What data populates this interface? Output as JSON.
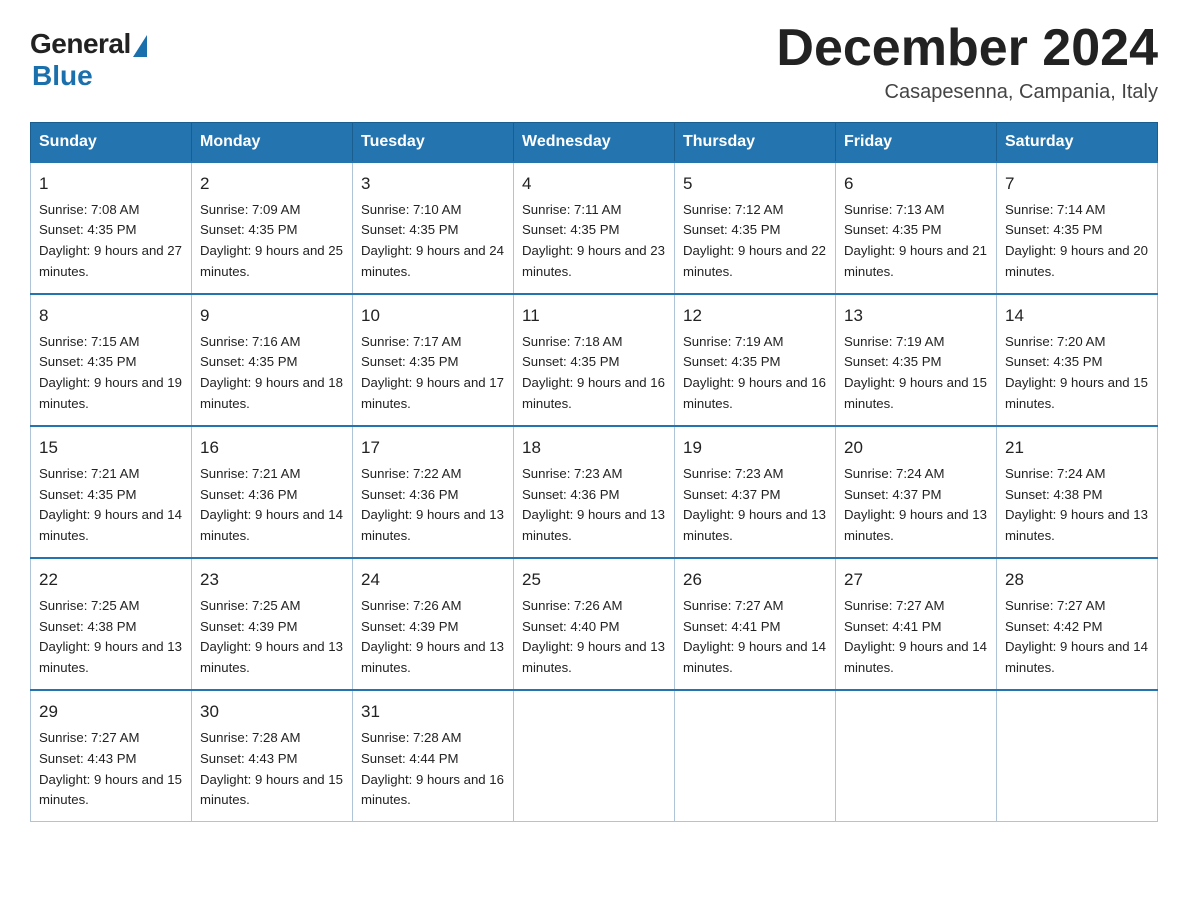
{
  "logo": {
    "general": "General",
    "blue": "Blue"
  },
  "title": {
    "month_year": "December 2024",
    "location": "Casapesenna, Campania, Italy"
  },
  "header_days": [
    "Sunday",
    "Monday",
    "Tuesday",
    "Wednesday",
    "Thursday",
    "Friday",
    "Saturday"
  ],
  "weeks": [
    [
      {
        "day": "1",
        "sunrise": "7:08 AM",
        "sunset": "4:35 PM",
        "daylight": "9 hours and 27 minutes."
      },
      {
        "day": "2",
        "sunrise": "7:09 AM",
        "sunset": "4:35 PM",
        "daylight": "9 hours and 25 minutes."
      },
      {
        "day": "3",
        "sunrise": "7:10 AM",
        "sunset": "4:35 PM",
        "daylight": "9 hours and 24 minutes."
      },
      {
        "day": "4",
        "sunrise": "7:11 AM",
        "sunset": "4:35 PM",
        "daylight": "9 hours and 23 minutes."
      },
      {
        "day": "5",
        "sunrise": "7:12 AM",
        "sunset": "4:35 PM",
        "daylight": "9 hours and 22 minutes."
      },
      {
        "day": "6",
        "sunrise": "7:13 AM",
        "sunset": "4:35 PM",
        "daylight": "9 hours and 21 minutes."
      },
      {
        "day": "7",
        "sunrise": "7:14 AM",
        "sunset": "4:35 PM",
        "daylight": "9 hours and 20 minutes."
      }
    ],
    [
      {
        "day": "8",
        "sunrise": "7:15 AM",
        "sunset": "4:35 PM",
        "daylight": "9 hours and 19 minutes."
      },
      {
        "day": "9",
        "sunrise": "7:16 AM",
        "sunset": "4:35 PM",
        "daylight": "9 hours and 18 minutes."
      },
      {
        "day": "10",
        "sunrise": "7:17 AM",
        "sunset": "4:35 PM",
        "daylight": "9 hours and 17 minutes."
      },
      {
        "day": "11",
        "sunrise": "7:18 AM",
        "sunset": "4:35 PM",
        "daylight": "9 hours and 16 minutes."
      },
      {
        "day": "12",
        "sunrise": "7:19 AM",
        "sunset": "4:35 PM",
        "daylight": "9 hours and 16 minutes."
      },
      {
        "day": "13",
        "sunrise": "7:19 AM",
        "sunset": "4:35 PM",
        "daylight": "9 hours and 15 minutes."
      },
      {
        "day": "14",
        "sunrise": "7:20 AM",
        "sunset": "4:35 PM",
        "daylight": "9 hours and 15 minutes."
      }
    ],
    [
      {
        "day": "15",
        "sunrise": "7:21 AM",
        "sunset": "4:35 PM",
        "daylight": "9 hours and 14 minutes."
      },
      {
        "day": "16",
        "sunrise": "7:21 AM",
        "sunset": "4:36 PM",
        "daylight": "9 hours and 14 minutes."
      },
      {
        "day": "17",
        "sunrise": "7:22 AM",
        "sunset": "4:36 PM",
        "daylight": "9 hours and 13 minutes."
      },
      {
        "day": "18",
        "sunrise": "7:23 AM",
        "sunset": "4:36 PM",
        "daylight": "9 hours and 13 minutes."
      },
      {
        "day": "19",
        "sunrise": "7:23 AM",
        "sunset": "4:37 PM",
        "daylight": "9 hours and 13 minutes."
      },
      {
        "day": "20",
        "sunrise": "7:24 AM",
        "sunset": "4:37 PM",
        "daylight": "9 hours and 13 minutes."
      },
      {
        "day": "21",
        "sunrise": "7:24 AM",
        "sunset": "4:38 PM",
        "daylight": "9 hours and 13 minutes."
      }
    ],
    [
      {
        "day": "22",
        "sunrise": "7:25 AM",
        "sunset": "4:38 PM",
        "daylight": "9 hours and 13 minutes."
      },
      {
        "day": "23",
        "sunrise": "7:25 AM",
        "sunset": "4:39 PM",
        "daylight": "9 hours and 13 minutes."
      },
      {
        "day": "24",
        "sunrise": "7:26 AM",
        "sunset": "4:39 PM",
        "daylight": "9 hours and 13 minutes."
      },
      {
        "day": "25",
        "sunrise": "7:26 AM",
        "sunset": "4:40 PM",
        "daylight": "9 hours and 13 minutes."
      },
      {
        "day": "26",
        "sunrise": "7:27 AM",
        "sunset": "4:41 PM",
        "daylight": "9 hours and 14 minutes."
      },
      {
        "day": "27",
        "sunrise": "7:27 AM",
        "sunset": "4:41 PM",
        "daylight": "9 hours and 14 minutes."
      },
      {
        "day": "28",
        "sunrise": "7:27 AM",
        "sunset": "4:42 PM",
        "daylight": "9 hours and 14 minutes."
      }
    ],
    [
      {
        "day": "29",
        "sunrise": "7:27 AM",
        "sunset": "4:43 PM",
        "daylight": "9 hours and 15 minutes."
      },
      {
        "day": "30",
        "sunrise": "7:28 AM",
        "sunset": "4:43 PM",
        "daylight": "9 hours and 15 minutes."
      },
      {
        "day": "31",
        "sunrise": "7:28 AM",
        "sunset": "4:44 PM",
        "daylight": "9 hours and 16 minutes."
      },
      null,
      null,
      null,
      null
    ]
  ],
  "labels": {
    "sunrise": "Sunrise:",
    "sunset": "Sunset:",
    "daylight": "Daylight:"
  }
}
